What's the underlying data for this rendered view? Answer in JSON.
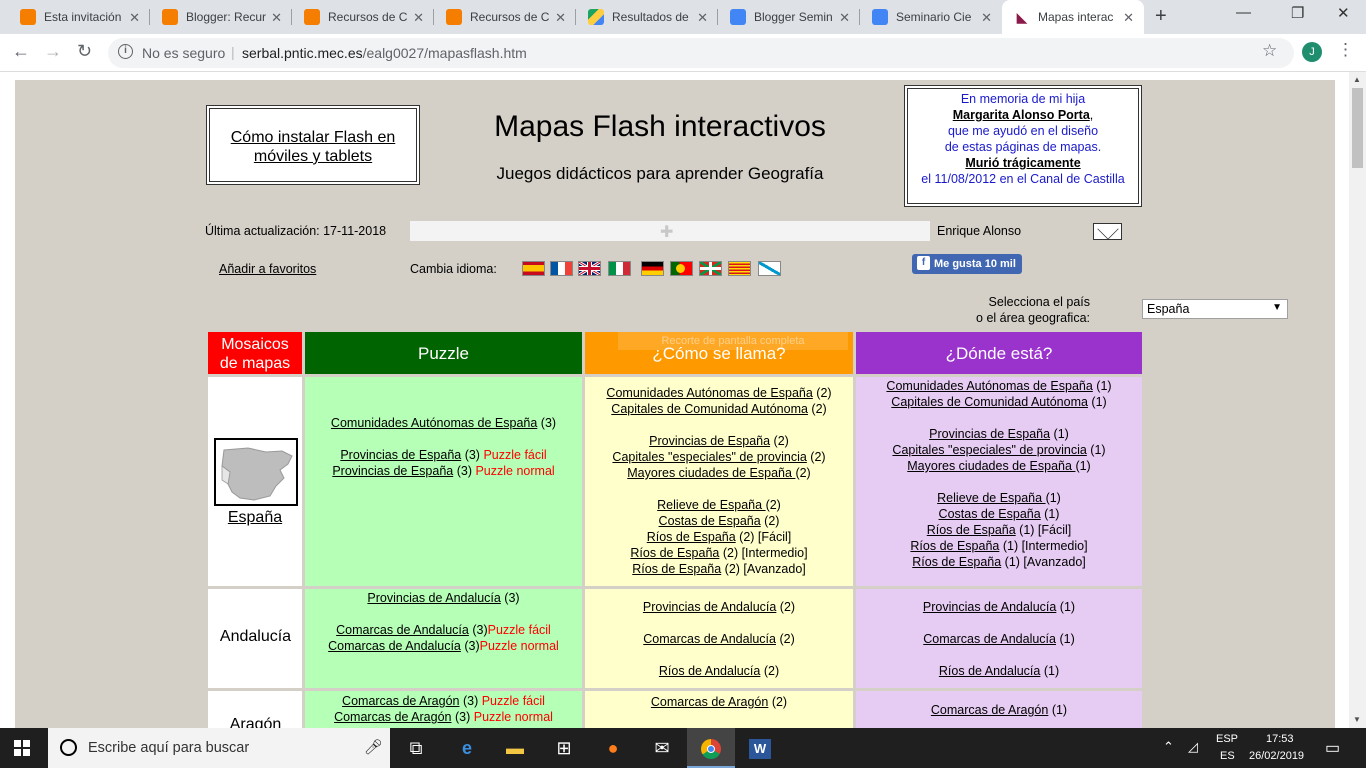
{
  "browser": {
    "tabs": [
      {
        "title": "Esta invitación",
        "icon": "blogger-icon"
      },
      {
        "title": "Blogger: Recur",
        "icon": "blogger-icon"
      },
      {
        "title": "Recursos de C",
        "icon": "blogger-icon"
      },
      {
        "title": "Recursos de C",
        "icon": "blogger-icon"
      },
      {
        "title": "Resultados de",
        "icon": "drive-icon"
      },
      {
        "title": "Blogger Semin",
        "icon": "docs-icon"
      },
      {
        "title": "Seminario Cie",
        "icon": "docs-icon"
      },
      {
        "title": "Mapas interac",
        "icon": "mapas-icon"
      }
    ],
    "security_label": "No es seguro",
    "url_domain": "serbal.pntic.mec.es",
    "url_path": "/ealg0027/mapasflash.htm",
    "avatar_letter": "J"
  },
  "page": {
    "flash_help": "Cómo instalar Flash en móviles y tablets",
    "title": "Mapas Flash interactivos",
    "subtitle": "Juegos didácticos para aprender Geografía",
    "memorial": [
      "En memoria de mi hija",
      "Margarita Alonso Porta",
      ",",
      "que me ayudó en el diseño",
      "de estas páginas de mapas.",
      "Murió trágicamente",
      "el 11/08/2012 en el Canal de Castilla"
    ],
    "last_update": "Última actualización: 17-11-2018",
    "author": "Enrique Alonso",
    "favorites": "Añadir a favoritos",
    "language_label": "Cambia idioma:",
    "flags": [
      "es",
      "fr",
      "gb",
      "it",
      "de",
      "pt",
      "eus",
      "cat",
      "gal"
    ],
    "facebook_like": "Me gusta 10 mil",
    "select_label_1": "Selecciona el país",
    "select_label_2": "o el área geografica:",
    "country_selected": "España",
    "ghost_text": "Recorte de pantalla completa",
    "headers": {
      "mosaicos_1": "Mosaicos",
      "mosaicos_2": "de mapas",
      "puzzle": "Puzzle",
      "como": "¿Cómo se llama?",
      "donde": "¿Dónde está?"
    },
    "rows": {
      "espana": {
        "label": "España",
        "puzzle": [
          [
            "Comunidades Autónomas de España",
            " (3)",
            ""
          ],
          [
            "",
            "",
            ""
          ],
          [
            "Provincias de España",
            " (3) ",
            "Puzzle fácil"
          ],
          [
            "Provincias de España",
            " (3) ",
            "Puzzle normal"
          ]
        ],
        "como": [
          [
            "Comunidades Autónomas de España",
            " (2)"
          ],
          [
            "Capitales de Comunidad Autónoma",
            " (2)"
          ],
          [
            "",
            ""
          ],
          [
            "Provincias de España",
            " (2)"
          ],
          [
            "Capitales \"especiales\" de provincia",
            " (2)"
          ],
          [
            "Mayores ciudades de España ",
            "(2)"
          ],
          [
            "",
            ""
          ],
          [
            "Relieve de España ",
            "(2)"
          ],
          [
            "Costas de España",
            " (2)"
          ],
          [
            "Ríos de España",
            " (2) [Fácil]"
          ],
          [
            "Ríos de España",
            " (2) [Intermedio]"
          ],
          [
            "Ríos de España",
            " (2) [Avanzado]"
          ]
        ],
        "donde": [
          [
            "Comunidades Autónomas de España",
            " (1)"
          ],
          [
            "Capitales de Comunidad Autónoma",
            " (1)"
          ],
          [
            "",
            ""
          ],
          [
            "Provincias de España",
            " (1)"
          ],
          [
            "Capitales \"especiales\" de provincia",
            " (1)"
          ],
          [
            "Mayores ciudades de España ",
            "(1)"
          ],
          [
            "",
            ""
          ],
          [
            "Relieve de España ",
            "(1)"
          ],
          [
            "Costas de España",
            " (1)"
          ],
          [
            "Ríos de España",
            " (1) [Fácil]"
          ],
          [
            "Ríos de España",
            " (1) [Intermedio]"
          ],
          [
            "Ríos de España",
            " (1) [Avanzado]"
          ]
        ]
      },
      "andalucia": {
        "label": "Andalucía",
        "puzzle": [
          [
            "Provincias de Andalucía",
            " (3)",
            ""
          ],
          [
            "",
            "",
            ""
          ],
          [
            "Comarcas de Andalucía",
            " (3)",
            "Puzzle fácil"
          ],
          [
            "Comarcas de Andalucía",
            " (3)",
            "Puzzle normal"
          ]
        ],
        "como": [
          [
            "Provincias de Andalucía",
            " (2)"
          ],
          [
            "",
            ""
          ],
          [
            "Comarcas de Andalucía",
            " (2)"
          ],
          [
            "",
            ""
          ],
          [
            "Ríos de Andalucía",
            " (2)"
          ]
        ],
        "donde": [
          [
            "Provincias de Andalucía",
            " (1)"
          ],
          [
            "",
            ""
          ],
          [
            "Comarcas de Andalucía",
            " (1)"
          ],
          [
            "",
            ""
          ],
          [
            "Ríos de Andalucía",
            " (1)"
          ]
        ]
      },
      "aragon": {
        "label": "Aragón",
        "puzzle": [
          [
            "Comarcas de Aragón",
            " (3) ",
            "Puzzle fácil"
          ],
          [
            "Comarcas de Aragón",
            " (3) ",
            "Puzzle normal"
          ]
        ],
        "como": [
          [
            "Comarcas de Aragón",
            " (2)"
          ]
        ],
        "donde": [
          [
            "Comarcas de Aragón",
            " (1)"
          ]
        ]
      }
    }
  },
  "taskbar": {
    "search_placeholder": "Escribe aquí para buscar",
    "lang_1": "ESP",
    "lang_2": "ES",
    "time": "17:53",
    "date": "26/02/2019"
  }
}
